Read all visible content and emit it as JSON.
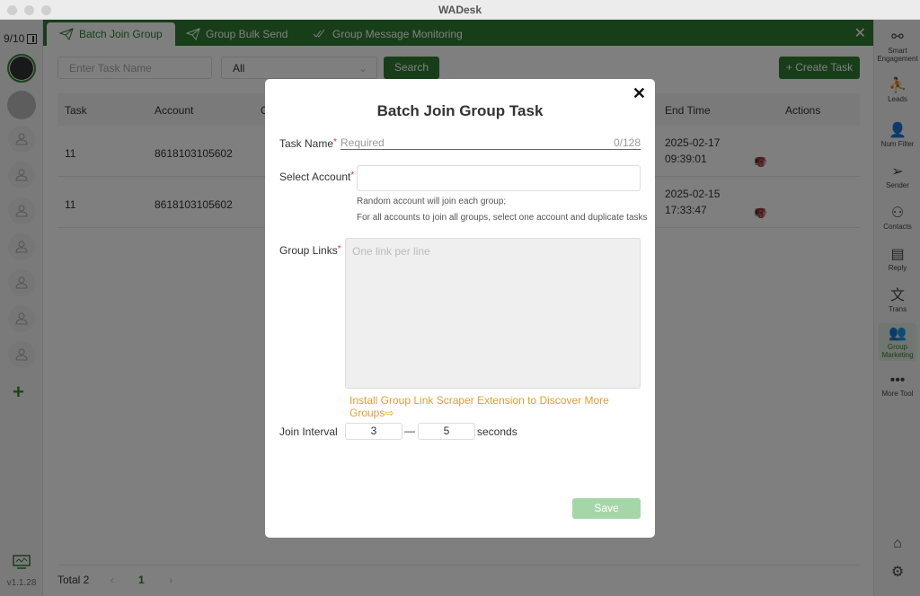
{
  "window": {
    "title": "WADesk"
  },
  "left_sidebar": {
    "account_count": "9/10",
    "version": "v1.1.28"
  },
  "tabs": [
    {
      "label": "Batch Join Group",
      "icon": "paper-plane-icon",
      "active": true
    },
    {
      "label": "Group Bulk Send",
      "icon": "paper-plane-icon",
      "active": false
    },
    {
      "label": "Group Message Monitoring",
      "icon": "double-check-icon",
      "active": false
    }
  ],
  "toolbar": {
    "search_placeholder": "Enter Task Name",
    "status_value": "All",
    "search_label": "Search",
    "create_label": "+ Create Task"
  },
  "table": {
    "columns": [
      "Task",
      "Account",
      "C",
      "End Time",
      "Actions"
    ],
    "rows": [
      {
        "task": "11",
        "account": "8618103105602",
        "end_date": "2025-02-17",
        "end_time": "09:39:01"
      },
      {
        "task": "11",
        "account": "8618103105602",
        "end_date": "2025-02-15",
        "end_time": "17:33:47"
      }
    ]
  },
  "pagination": {
    "total": "Total 2",
    "prev": "‹",
    "page": "1",
    "next": "›"
  },
  "right_sidebar": [
    {
      "label": "Smart Engagement",
      "icon": "share-nodes-icon"
    },
    {
      "label": "Leads",
      "icon": "person-pin-icon"
    },
    {
      "label": "Num Filter",
      "icon": "user-search-icon"
    },
    {
      "label": "Sender",
      "icon": "paper-plane-icon"
    },
    {
      "label": "Contacts",
      "icon": "contacts-icon"
    },
    {
      "label": "Reply",
      "icon": "chat-bubble-icon"
    },
    {
      "label": "Trans",
      "icon": "translate-icon"
    },
    {
      "label": "Group Marketing",
      "icon": "group-icon",
      "active": true
    },
    {
      "label": "More Tool",
      "icon": "ellipsis-icon"
    }
  ],
  "modal": {
    "title": "Batch Join Group Task",
    "task_name_label": "Task Name",
    "task_name_placeholder": "Required",
    "task_name_counter": "0/128",
    "select_account_label": "Select Account",
    "hint1": "Random account will join each group;",
    "hint2": "For all accounts to join all groups, select one account and duplicate tasks",
    "group_links_label": "Group Links",
    "group_links_placeholder": "One link per line",
    "extension_link": "Install Group Link Scraper Extension to Discover More Groups",
    "join_interval_label": "Join Interval",
    "interval_min": "3",
    "interval_max": "5",
    "interval_unit": "seconds",
    "save_label": "Save",
    "required_mark": "*"
  }
}
